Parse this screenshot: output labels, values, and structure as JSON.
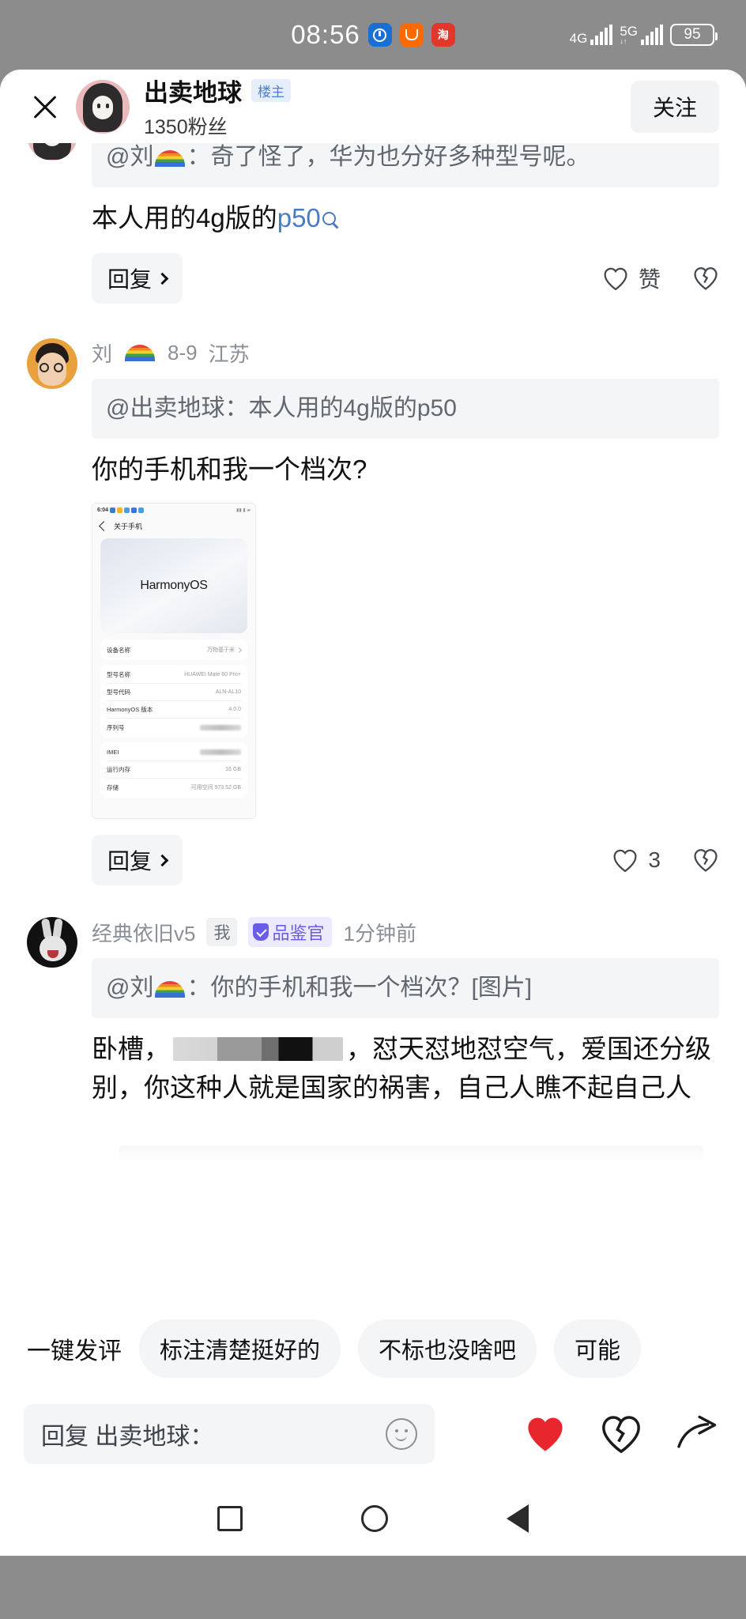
{
  "status_bar": {
    "time": "08:56",
    "app_icons": [
      "qq-icon",
      "alipay-icon",
      "taobao-icon"
    ],
    "network_primary": "4G",
    "network_secondary": "5G",
    "battery_percent": "95"
  },
  "header": {
    "close_icon": "close-icon",
    "author_name": "出卖地球",
    "author_badge": "楼主",
    "followers": "1350粉丝",
    "follow_label": "关注"
  },
  "comments": [
    {
      "avatar": "earth-avatar",
      "quote": "@刘🌈：奇了怪了，华为也分好多种型号呢。",
      "quote_prefix": "@刘",
      "quote_rest": "：奇了怪了，华为也分好多种型号呢。",
      "text_prefix": "本人用的4g版的",
      "text_link": "p50",
      "reply_label": "回复",
      "like_label": "赞",
      "dislike_icon": "broken-heart-icon"
    },
    {
      "avatar": "liu-avatar",
      "user": "刘",
      "date": "8-9",
      "location": "江苏",
      "quote": "@出卖地球：本人用的4g版的p50",
      "text": "你的手机和我一个档次?",
      "reply_label": "回复",
      "like_count": "3",
      "dislike_icon": "broken-heart-icon",
      "image": {
        "status_time": "6:04",
        "nav_title": "关于手机",
        "back_icon": "back-arrow-icon",
        "banner_text": "HarmonyOS",
        "banner_underline": "O",
        "rows": [
          {
            "key": "设备名称",
            "value": "万物基于米",
            "has_arrow": true
          },
          {
            "key": "型号名称",
            "value": "HUAWEI Mate 60 Pro+",
            "has_arrow": false
          },
          {
            "key": "型号代码",
            "value": "ALN-AL10",
            "has_arrow": false
          },
          {
            "key": "HarmonyOS 版本",
            "value": "4.0.0",
            "has_arrow": false
          },
          {
            "key": "序列号",
            "value": "",
            "has_arrow": false,
            "blurred": true
          },
          {
            "key": "IMEI",
            "value": "",
            "has_arrow": false,
            "blurred": true
          },
          {
            "key": "运行内存",
            "value": "16 GB",
            "has_arrow": false
          },
          {
            "key": "存储",
            "value": "可用空间 973.52 GB",
            "has_arrow": false
          }
        ]
      }
    },
    {
      "avatar": "rabbit-avatar",
      "user": "经典依旧v5",
      "badge_me": "我",
      "badge_verified": "品鉴官",
      "time": "1分钟前",
      "quote": "@刘🌈：你的手机和我一个档次？[图片]",
      "quote_prefix": "@刘",
      "quote_rest": "：你的手机和我一个档次？[图片]",
      "text_part1": "卧槽，",
      "text_part2": "，怼天怼地怼空气，爱国还分级别，你这种人就是国家的祸害，自己人瞧不起自己人"
    }
  ],
  "quick_reply": {
    "lead_label": "一键发评",
    "chips": [
      "标注清楚挺好的",
      "不标也没啥吧",
      "可能"
    ]
  },
  "bottom_bar": {
    "input_placeholder": "回复 出卖地球：",
    "emoji_icon": "smiley-icon",
    "like_icon": "heart-filled-icon",
    "dislike_icon": "broken-heart-icon",
    "share_icon": "share-arrow-icon"
  },
  "nav_bar": {
    "recents_icon": "square-icon",
    "home_icon": "circle-icon",
    "back_icon": "triangle-back-icon"
  },
  "colors": {
    "accent_link": "#4b7bc4",
    "like_red": "#e8262d",
    "badge_blue_bg": "#e6eefc",
    "badge_purple": "#6b5ce7",
    "sheet_bg": "#ffffff",
    "quote_bg": "#f4f5f7"
  }
}
